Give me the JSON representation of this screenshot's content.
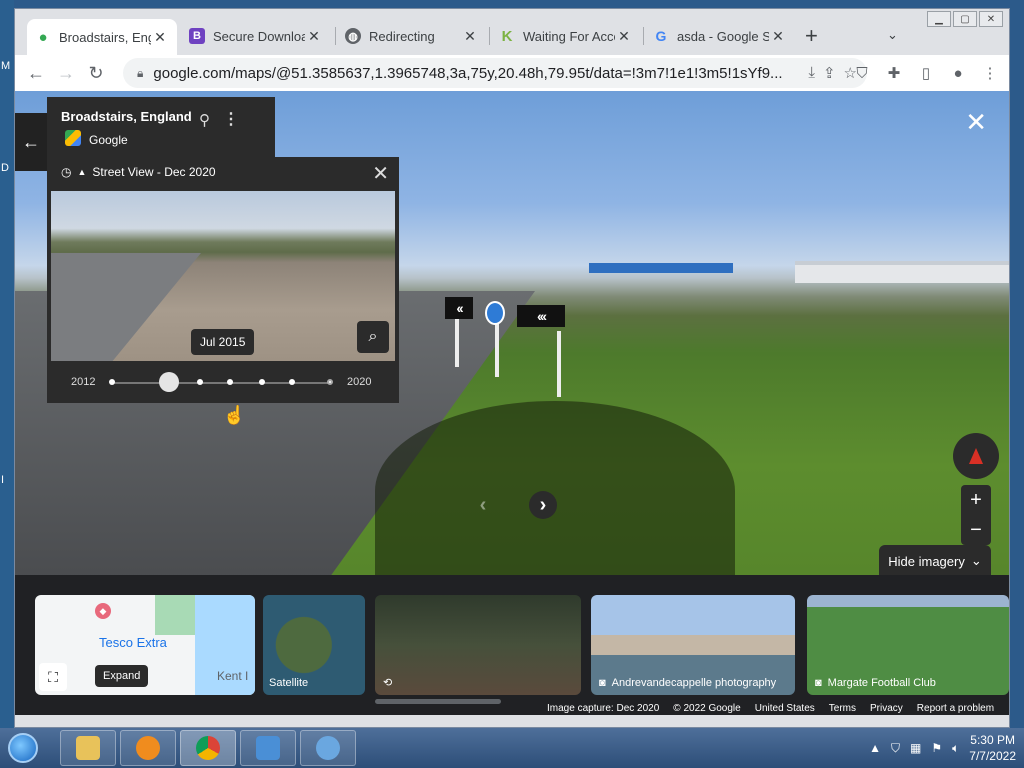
{
  "browser": {
    "tabs": [
      {
        "title": "Broadstairs, Engl",
        "icon": "maps-pin-icon",
        "active": true
      },
      {
        "title": "Secure Downloac",
        "icon": "bootstrap-b-icon"
      },
      {
        "title": "Redirecting",
        "icon": "globe-icon"
      },
      {
        "title": "Waiting For Acce",
        "icon": "k-logo-icon"
      },
      {
        "title": "asda - Google Se",
        "icon": "google-g-icon"
      }
    ],
    "url": "google.com/maps/@51.3585637,1.3965748,3a,75y,20.48h,79.95t/data=!3m7!1e1!3m5!1sYf9...",
    "window_controls": [
      "minimize",
      "maximize",
      "close"
    ]
  },
  "place": {
    "title": "Broadstairs, England",
    "source": "Google"
  },
  "time_travel": {
    "header": "Street View - Dec 2020",
    "tooltip": "Jul 2015",
    "start_year": "2012",
    "end_year": "2020",
    "selected_fraction": 0.25
  },
  "street_view": {
    "hide_imagery_label": "Hide imagery"
  },
  "filmstrip": {
    "map_labels": {
      "tesco": "Tesco Extra",
      "kent": "Kent I"
    },
    "expand_tooltip": "Expand",
    "cards": [
      {
        "label": "Satellite"
      },
      {
        "label": ""
      },
      {
        "label": "Andrevandecappelle photography"
      },
      {
        "label": "Margate Football Club"
      }
    ]
  },
  "footer": {
    "capture": "Image capture: Dec 2020",
    "copyright": "© 2022 Google",
    "region": "United States",
    "terms": "Terms",
    "privacy": "Privacy",
    "report": "Report a problem"
  },
  "taskbar": {
    "time": "5:30 PM",
    "date": "7/7/2022"
  },
  "colors": {
    "tab_active_bg": "#ffffff",
    "tabstrip_bg": "#dfe1e5",
    "panel_bg": "#2b2b2b",
    "accent_blue": "#1a73e8"
  }
}
